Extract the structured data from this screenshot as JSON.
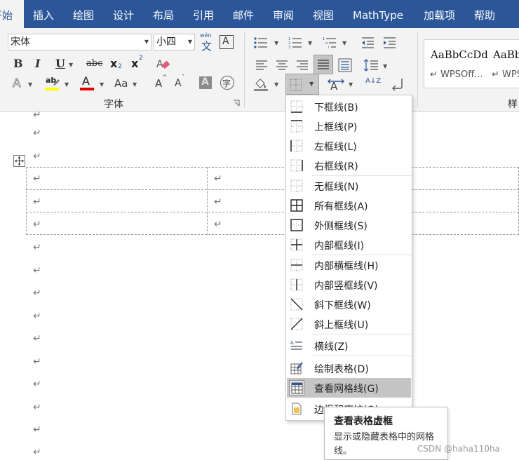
{
  "ribbon_tabs": [
    {
      "label": "开始",
      "active": true
    },
    {
      "label": "插入"
    },
    {
      "label": "绘图"
    },
    {
      "label": "设计"
    },
    {
      "label": "布局"
    },
    {
      "label": "引用"
    },
    {
      "label": "邮件"
    },
    {
      "label": "审阅"
    },
    {
      "label": "视图"
    },
    {
      "label": "MathType"
    },
    {
      "label": "加载项"
    },
    {
      "label": "帮助"
    }
  ],
  "font_group": {
    "font_name": "宋体",
    "font_size": "小四",
    "phonetic_glyph": "文",
    "phonetic_ruby": "wén",
    "border_char_glyph": "A",
    "bold": "B",
    "italic": "I",
    "underline": "U",
    "strike": "abc",
    "subscript_base": "x",
    "subscript_mark": "2",
    "superscript_base": "x",
    "superscript_mark": "2",
    "text_effect": "A",
    "highlight": "ab",
    "font_color": "A",
    "change_case": "Aa",
    "grow_font": "A",
    "shrink_font": "A",
    "char_shading": "A",
    "enclose_char": "字",
    "label": "字体",
    "colors": {
      "highlight": "#ffff00",
      "font_color": "#e00000",
      "accent": "#2b579a"
    }
  },
  "paragraph_group": {
    "sort_glyph": "A↓Z"
  },
  "styles_group": {
    "items": [
      {
        "preview": "AaBbCcDd",
        "name": "↵ WPSOff..."
      },
      {
        "preview": "AaBb",
        "name": "↵ WPS"
      }
    ],
    "label": "样"
  },
  "document": {
    "paragraph_mark": "↵",
    "move_handle_icon": "move-icon"
  },
  "border_menu": {
    "items": [
      {
        "label": "下框线(B)",
        "icon": "bottom-border-icon"
      },
      {
        "label": "上框线(P)",
        "icon": "top-border-icon"
      },
      {
        "label": "左框线(L)",
        "icon": "left-border-icon"
      },
      {
        "label": "右框线(R)",
        "icon": "right-border-icon"
      },
      {
        "label": "无框线(N)",
        "icon": "no-border-icon"
      },
      {
        "label": "所有框线(A)",
        "icon": "all-borders-icon"
      },
      {
        "label": "外侧框线(S)",
        "icon": "outside-borders-icon"
      },
      {
        "label": "内部框线(I)",
        "icon": "inside-borders-icon"
      },
      {
        "label": "内部横框线(H)",
        "icon": "inside-horizontal-border-icon"
      },
      {
        "label": "内部竖框线(V)",
        "icon": "inside-vertical-border-icon"
      },
      {
        "label": "斜下框线(W)",
        "icon": "diagonal-down-border-icon"
      },
      {
        "label": "斜上框线(U)",
        "icon": "diagonal-up-border-icon"
      },
      {
        "label": "横线(Z)",
        "icon": "horizontal-line-icon"
      },
      {
        "label": "绘制表格(D)",
        "icon": "draw-table-icon"
      },
      {
        "label": "查看网格线(G)",
        "icon": "view-gridlines-icon",
        "highlighted": true
      },
      {
        "label": "边框和底纹(O)...",
        "icon": "borders-shading-icon"
      }
    ]
  },
  "tooltip": {
    "title": "查看表格虚框",
    "description": "显示或隐藏表格中的网格线。"
  },
  "watermark": "CSDN @haha110ha"
}
